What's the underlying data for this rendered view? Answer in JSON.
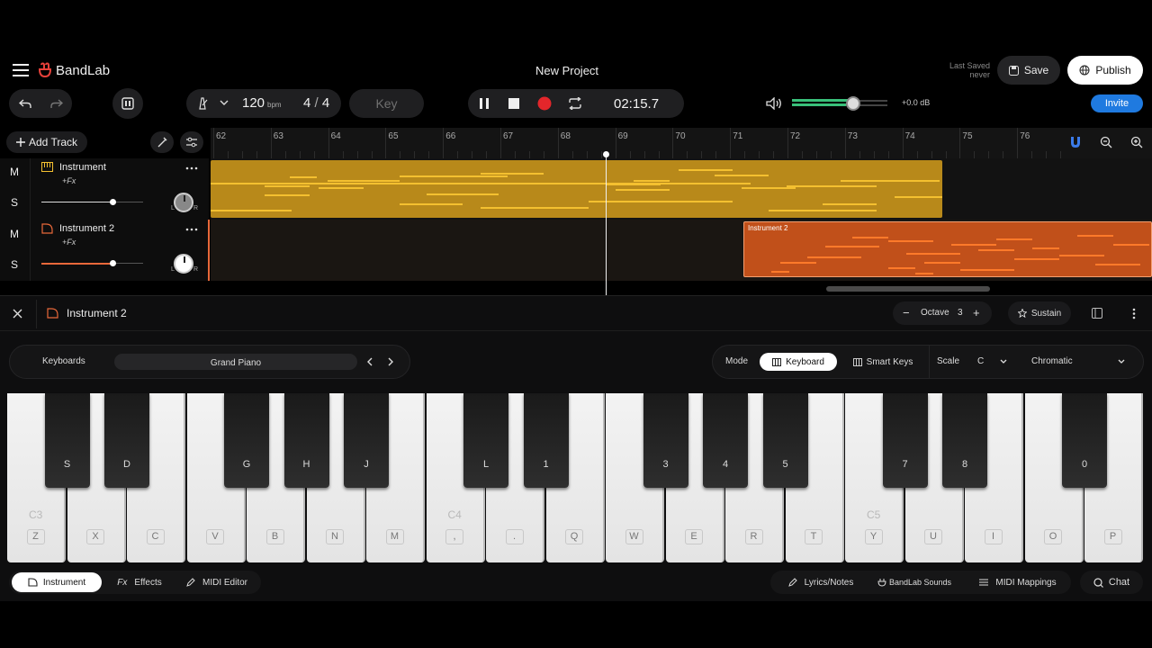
{
  "app": {
    "name": "BandLab",
    "project_title": "New Project",
    "last_saved_label": "Last Saved",
    "last_saved_value": "never"
  },
  "header": {
    "save_label": "Save",
    "publish_label": "Publish",
    "invite_label": "Invite"
  },
  "transport": {
    "tempo": "120",
    "tempo_unit": "bpm",
    "time_sig_num": "4",
    "time_sig_sep": "/",
    "time_sig_den": "4",
    "key_label": "Key",
    "time": "02:15.7",
    "volume_db": "+0.0 dB"
  },
  "tracks_panel": {
    "add_track_label": "Add Track"
  },
  "tracks": [
    {
      "name": "Instrument",
      "fx": "+Fx",
      "mute": "M",
      "solo": "S",
      "L": "L",
      "R": "R"
    },
    {
      "name": "Instrument 2",
      "fx": "+Fx",
      "mute": "M",
      "solo": "S",
      "L": "L",
      "R": "R"
    }
  ],
  "ruler": [
    "62",
    "63",
    "64",
    "65",
    "66",
    "67",
    "68",
    "69",
    "70",
    "71",
    "72",
    "73",
    "74",
    "75",
    "76"
  ],
  "clips": {
    "clip2_label": "Instrument 2"
  },
  "instrument_panel": {
    "title": "Instrument 2",
    "octave_label": "Octave",
    "octave_value": "3",
    "minus": "−",
    "plus": "+",
    "sustain_label": "Sustain",
    "keyboards_label": "Keyboards",
    "preset": "Grand Piano",
    "mode_label": "Mode",
    "mode_keyboard": "Keyboard",
    "mode_smart": "Smart Keys",
    "scale_label": "Scale",
    "scale_root": "C",
    "scale_type": "Chromatic"
  },
  "keyboard": {
    "white_keys": [
      "Z",
      "X",
      "C",
      "V",
      "B",
      "N",
      "M",
      ",",
      ".",
      "Q",
      "W",
      "E",
      "R",
      "T",
      "Y",
      "U",
      "I",
      "O",
      "P"
    ],
    "black_keys": [
      "S",
      "D",
      "G",
      "H",
      "J",
      "L",
      "1",
      "3",
      "4",
      "5",
      "7",
      "8",
      "0"
    ],
    "octave_labels": [
      "C3",
      "C4",
      "C5"
    ]
  },
  "bottom_bar": {
    "instrument": "Instrument",
    "effects_prefix": "Fx",
    "effects": "Effects",
    "midi_editor": "MIDI Editor",
    "lyrics": "Lyrics/Notes",
    "sounds": "BandLab Sounds",
    "midi_mappings": "MIDI Mappings",
    "chat": "Chat"
  },
  "colors": {
    "accent_blue": "#1f7ae0",
    "track1_clip": "#b8891a",
    "track2_clip": "#d2561a",
    "record_red": "#e3262b",
    "brand_red": "#e8413a"
  },
  "icons": [
    "menu-icon",
    "bandlab-logo-icon",
    "undo-icon",
    "redo-icon",
    "panel-icon",
    "metronome-icon",
    "chevron-down-icon",
    "pause-icon",
    "stop-icon",
    "record-icon",
    "loop-icon",
    "speaker-icon",
    "save-icon",
    "globe-icon",
    "magnet-icon",
    "zoom-out-icon",
    "zoom-in-icon",
    "plus-icon",
    "tune-icon",
    "mixer-icon",
    "piano-icon",
    "more-icon",
    "close-icon",
    "star-icon",
    "layout-icon",
    "chevron-left-icon",
    "chevron-right-icon",
    "pencil-icon",
    "chat-icon"
  ]
}
